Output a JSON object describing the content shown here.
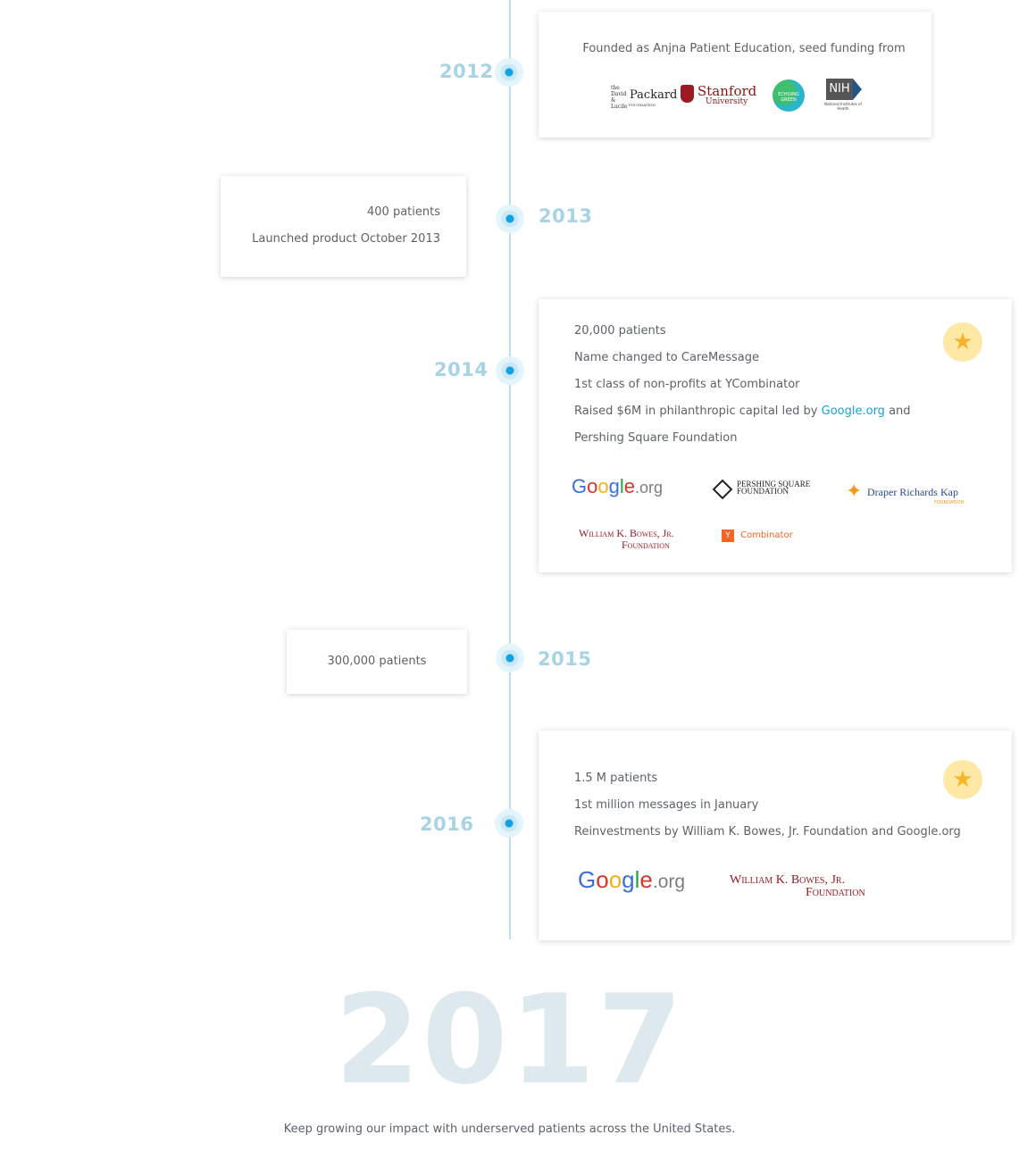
{
  "timeline": {
    "y2012": {
      "year": "2012",
      "text": "Founded as Anjna Patient Education, seed funding from",
      "logos": {
        "packard_small": "the David & Lucile",
        "packard_name": "Packard",
        "packard_foundation": "FOUNDATION",
        "stanford_name": "Stanford",
        "stanford_sub": "University",
        "echoing": "ECHOING GREEN",
        "nih": "NIH",
        "nih_sub": "National Institutes of Health"
      }
    },
    "y2013": {
      "year": "2013",
      "lines": [
        "400 patients",
        "Launched product October 2013"
      ]
    },
    "y2014": {
      "year": "2014",
      "lines": [
        "20,000 patients",
        "Name changed to CareMessage",
        "1st class of non-profits at YCombinator"
      ],
      "raised_prefix": "Raised $6M in philanthropic capital led by",
      "raised_link": "Google.org",
      "raised_suffix": "and",
      "raised_line2": "Pershing Square Foundation",
      "logos": {
        "google_org": ".org",
        "pershing_1": "PERSHING SQUARE",
        "pershing_2": "FOUNDATION",
        "draper": "Draper Richards Kap",
        "draper_sub": "FOUNDATION",
        "bowes_1": "William K. Bowes, Jr.",
        "bowes_2": "Foundation",
        "yc_mark": "Y",
        "yc_name": "Combinator"
      }
    },
    "y2015": {
      "year": "2015",
      "text": "300,000 patients"
    },
    "y2016": {
      "year": "2016",
      "lines": [
        "1.5 M patients",
        "1st million messages in January",
        "Reinvestments by William K. Bowes, Jr. Foundation and Google.org"
      ],
      "logos": {
        "google_org": ".org",
        "bowes_1": "William K. Bowes, Jr.",
        "bowes_2": "Foundation"
      }
    }
  },
  "future": {
    "year": "2017",
    "text": "Keep growing our impact with underserved patients across the United States."
  },
  "colors": {
    "accent": "#12a2e1",
    "line": "#b9dff0",
    "year": "#a8d3e4",
    "star": "#f7b52c"
  }
}
